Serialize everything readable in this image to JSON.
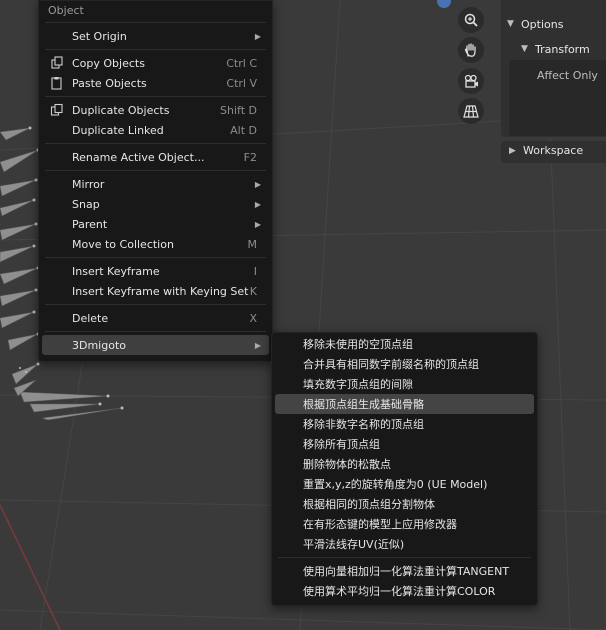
{
  "menu": {
    "title": "Object",
    "items": [
      {
        "label": "Set Origin",
        "shortcut": "",
        "submenu": true,
        "icon": ""
      },
      {
        "label": "Copy Objects",
        "shortcut": "Ctrl C",
        "submenu": false,
        "icon": "copy-icon"
      },
      {
        "label": "Paste Objects",
        "shortcut": "Ctrl V",
        "submenu": false,
        "icon": "paste-icon"
      },
      {
        "label": "Duplicate Objects",
        "shortcut": "Shift D",
        "submenu": false,
        "icon": "duplicate-icon"
      },
      {
        "label": "Duplicate Linked",
        "shortcut": "Alt D",
        "submenu": false,
        "icon": ""
      },
      {
        "label": "Rename Active Object...",
        "shortcut": "F2",
        "submenu": false,
        "icon": ""
      },
      {
        "label": "Mirror",
        "shortcut": "",
        "submenu": true,
        "icon": ""
      },
      {
        "label": "Snap",
        "shortcut": "",
        "submenu": true,
        "icon": ""
      },
      {
        "label": "Parent",
        "shortcut": "",
        "submenu": true,
        "icon": ""
      },
      {
        "label": "Move to Collection",
        "shortcut": "M",
        "submenu": false,
        "icon": ""
      },
      {
        "label": "Insert Keyframe",
        "shortcut": "I",
        "submenu": false,
        "icon": ""
      },
      {
        "label": "Insert Keyframe with Keying Set",
        "shortcut": "K",
        "submenu": false,
        "icon": ""
      },
      {
        "label": "Delete",
        "shortcut": "X",
        "submenu": false,
        "icon": ""
      },
      {
        "label": "3Dmigoto",
        "shortcut": "",
        "submenu": true,
        "icon": ""
      }
    ]
  },
  "submenu": {
    "items": [
      {
        "label": "移除未使用的空顶点组"
      },
      {
        "label": "合并具有相同数字前缀名称的顶点组"
      },
      {
        "label": "填充数字顶点组的间隙"
      },
      {
        "label": "根据顶点组生成基础骨骼"
      },
      {
        "label": "移除非数字名称的顶点组"
      },
      {
        "label": "移除所有顶点组"
      },
      {
        "label": "删除物体的松散点"
      },
      {
        "label": "重置x,y,z的旋转角度为0 (UE Model)"
      },
      {
        "label": "根据相同的顶点组分割物体"
      },
      {
        "label": "在有形态键的模型上应用修改器"
      },
      {
        "label": "平滑法线存UV(近似)"
      },
      {
        "label": "使用向量相加归一化算法重计算TANGENT"
      },
      {
        "label": "使用算术平均归一化算法重计算COLOR"
      }
    ]
  },
  "npanel": {
    "options_label": "Options",
    "transform_label": "Transform",
    "affect_only_label": "Affect Only",
    "workspace_label": "Workspace"
  },
  "nav_icons": [
    "zoom-icon",
    "hand-icon",
    "camera-icon",
    "grid-icon"
  ]
}
